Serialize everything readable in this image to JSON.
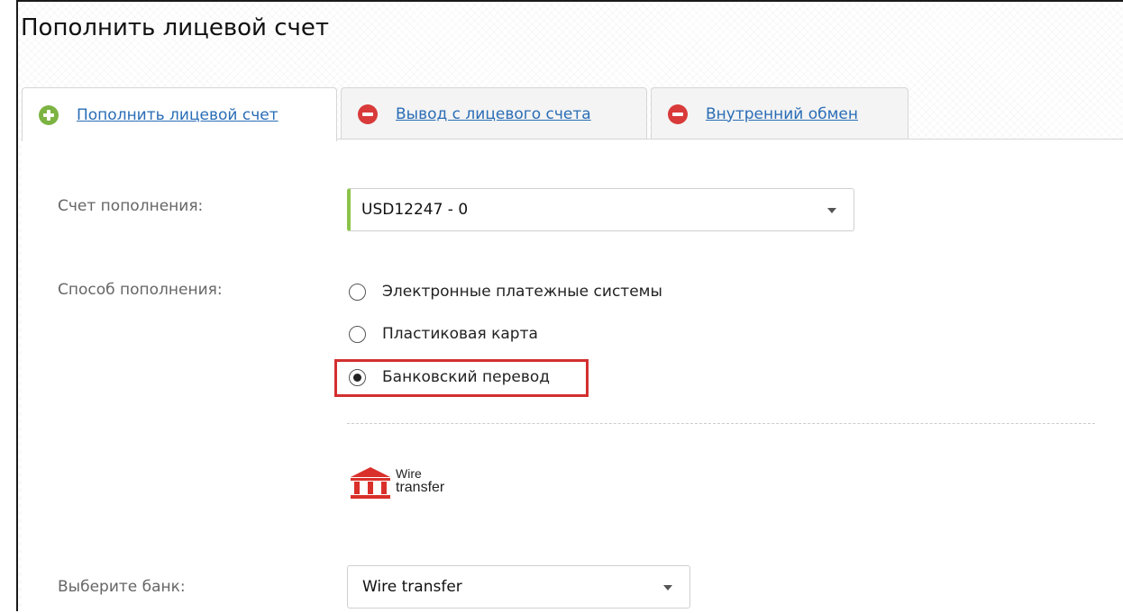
{
  "page": {
    "title": "Пополнить лицевой счет"
  },
  "tabs": [
    {
      "label": "Пополнить лицевой счет",
      "icon": "plus-circle-icon",
      "active": true
    },
    {
      "label": "Вывод с лицевого счета",
      "icon": "minus-circle-icon",
      "active": false
    },
    {
      "label": "Внутренний обмен",
      "icon": "minus-circle-icon",
      "active": false
    }
  ],
  "form": {
    "account": {
      "label": "Счет пополнения:",
      "value": "USD12247 - 0"
    },
    "method": {
      "label": "Способ пополнения:",
      "options": [
        {
          "label": "Электронные платежные системы",
          "checked": false
        },
        {
          "label": "Пластиковая карта",
          "checked": false
        },
        {
          "label": "Банковский перевод",
          "checked": true
        }
      ]
    },
    "logo": {
      "line1": "Wire",
      "line2": "transfer"
    },
    "bank": {
      "label": "Выберите банк:",
      "value": "Wire transfer"
    }
  },
  "colors": {
    "accent_green": "#8bc34a",
    "tab_plus": "#7cb342",
    "tab_minus": "#d93a3a",
    "link_blue": "#2a6db6",
    "highlight_red": "#d32f2f",
    "logo_red": "#d9302b"
  }
}
